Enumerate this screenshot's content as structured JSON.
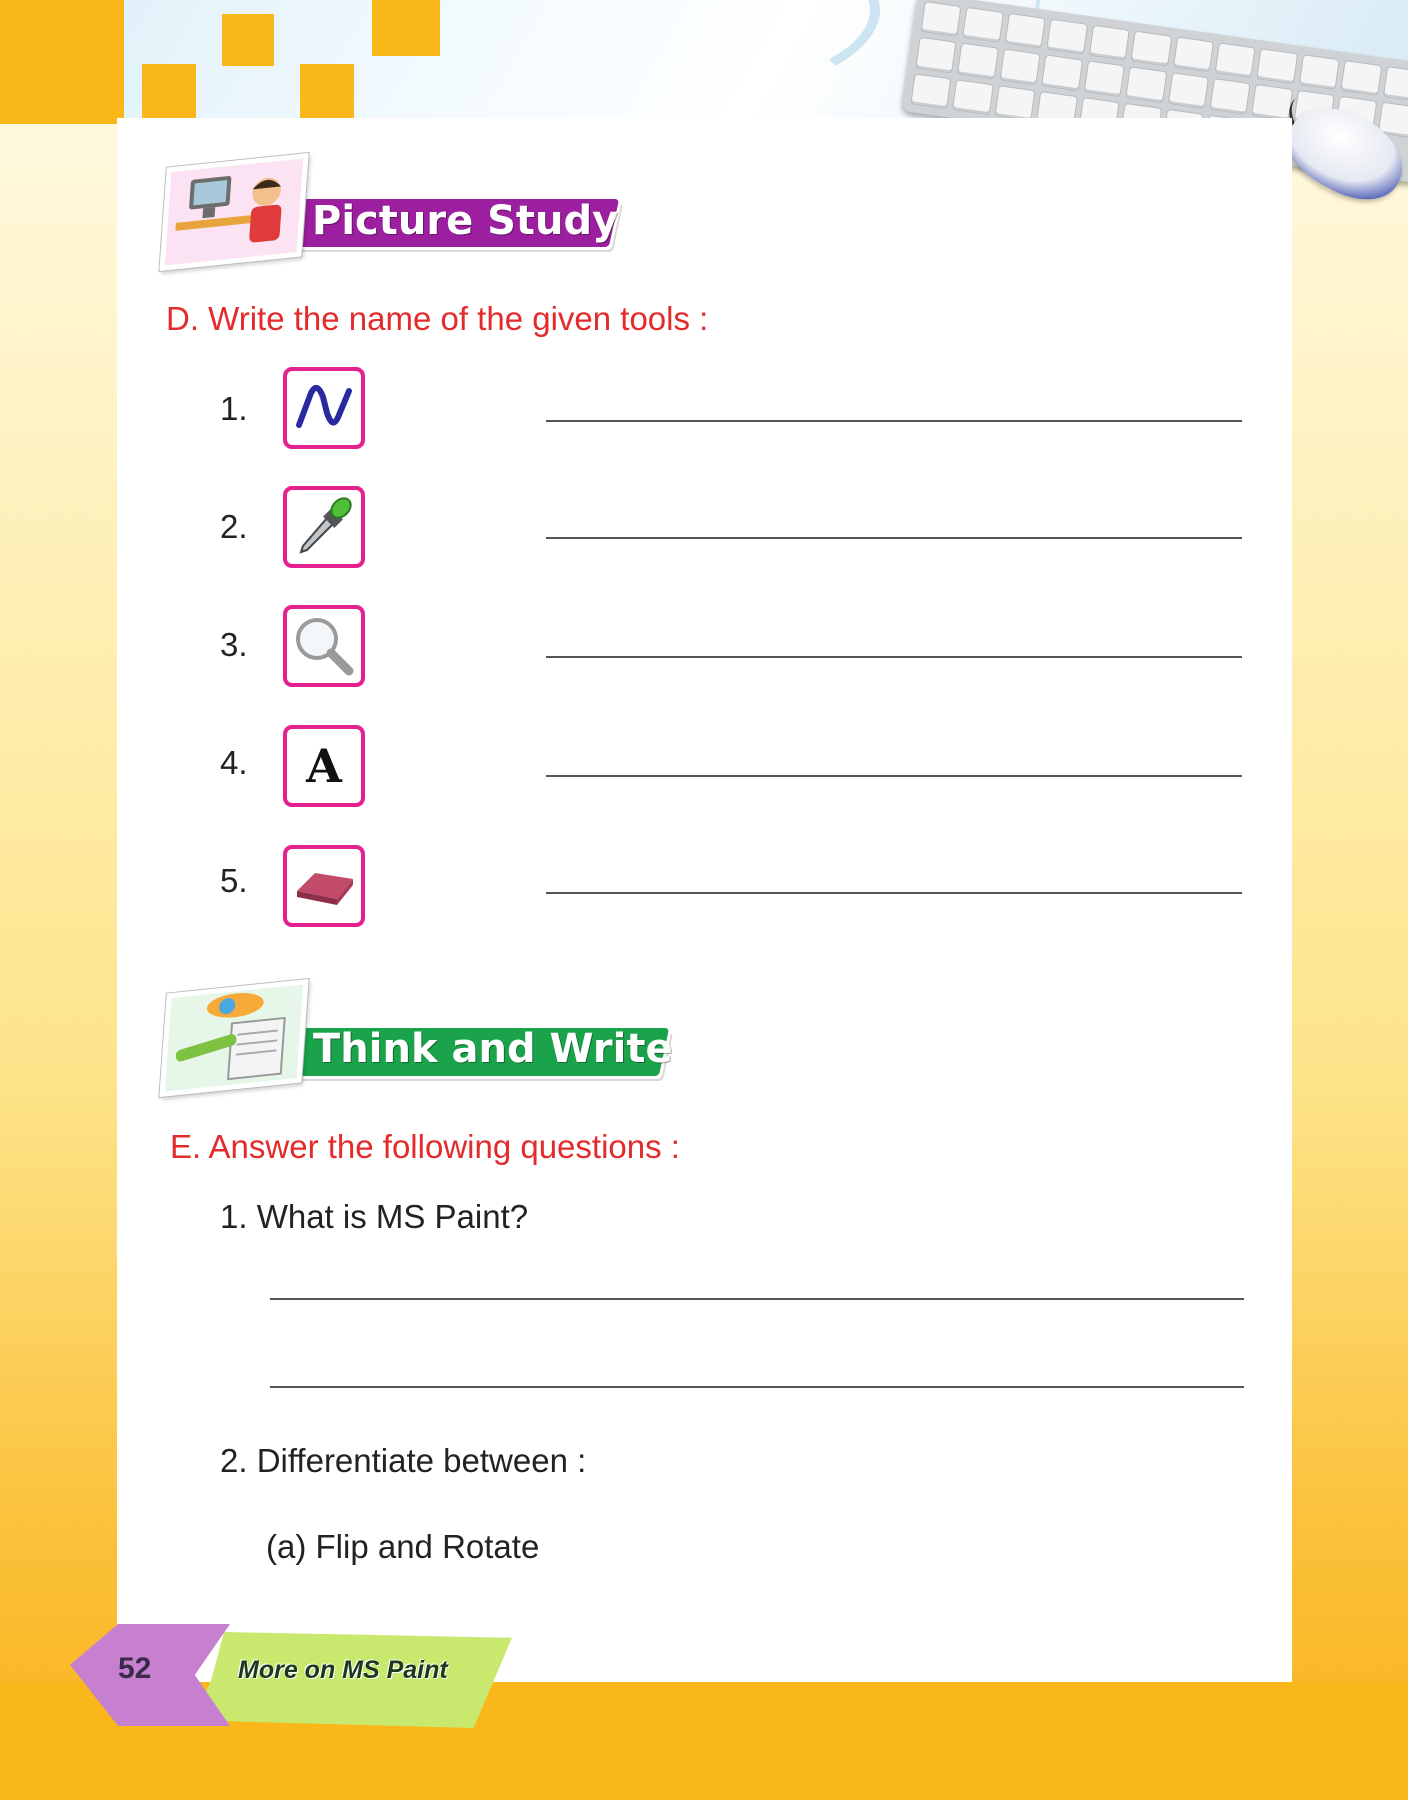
{
  "headings": {
    "picture_study": "Picture Study",
    "think_and_write": "Think and Write"
  },
  "section_d": {
    "label": "D.  Write the name of the given tools :",
    "items": [
      {
        "number": "1.",
        "icon": "curve-icon"
      },
      {
        "number": "2.",
        "icon": "color-picker-icon"
      },
      {
        "number": "3.",
        "icon": "magnifier-icon"
      },
      {
        "number": "4.",
        "icon": "text-icon",
        "glyph": "A"
      },
      {
        "number": "5.",
        "icon": "eraser-icon"
      }
    ]
  },
  "section_e": {
    "label": "E.  Answer the following questions :",
    "q1": "1.  What is MS Paint?",
    "q2": "2.  Differentiate between :",
    "q2a": "(a) Flip and Rotate"
  },
  "footer": {
    "page_number": "52",
    "chapter_title": "More on MS Paint"
  },
  "colors": {
    "accent_yellow": "#f9b719",
    "question_red": "#e32b2b",
    "box_magenta": "#e4208f",
    "picture_study_purple": "#9b1f9e",
    "think_write_green": "#1aa34a"
  }
}
